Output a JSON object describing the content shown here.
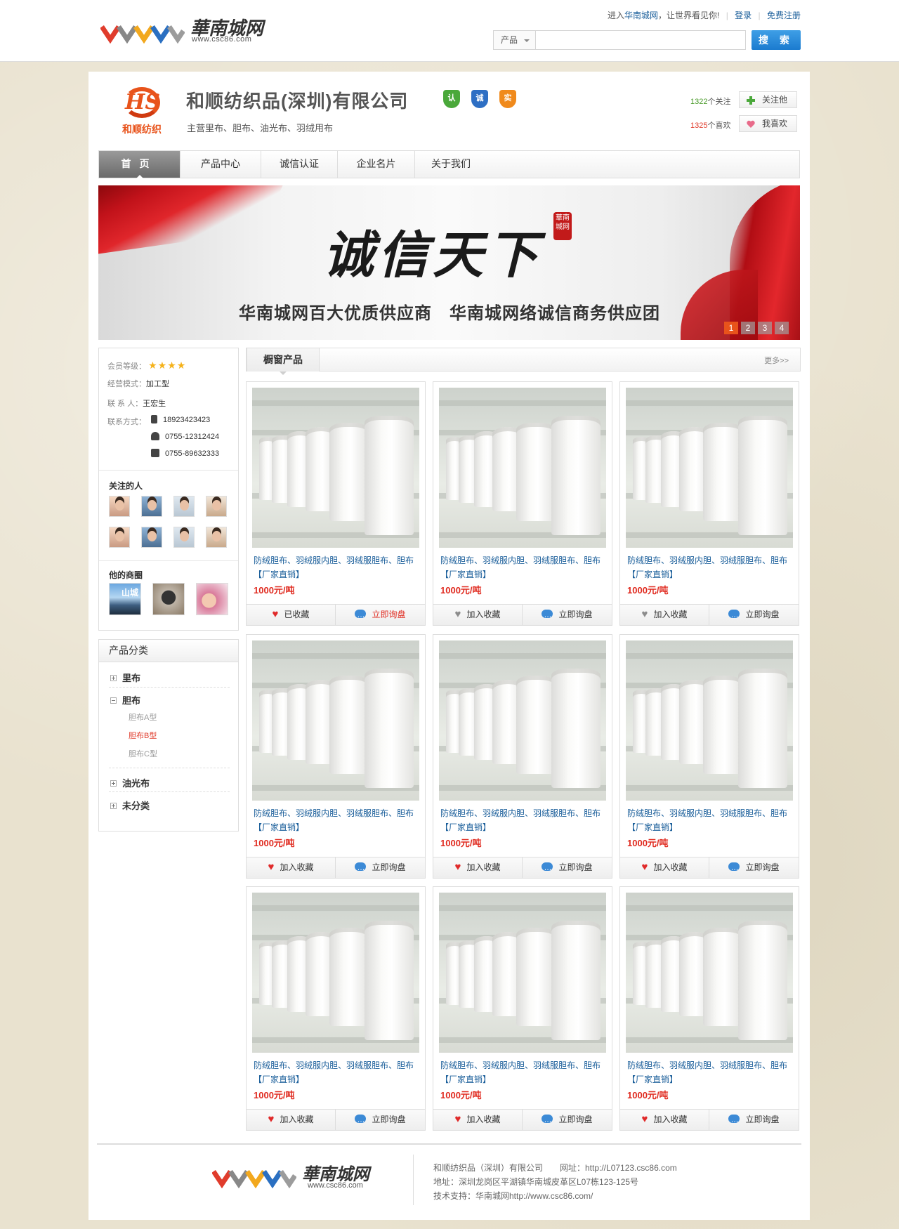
{
  "header": {
    "site_brand": "華南城网",
    "site_url": "www.csc86.com",
    "intro_prefix": "进入",
    "intro_site": "华南城网",
    "intro_suffix": "，让世界看见你!",
    "login": "登录",
    "register": "免费注册",
    "search_scope": "产品",
    "search_placeholder": "",
    "search_button": "搜 索"
  },
  "company": {
    "logo_letters": "HS",
    "logo_text": "和顺纺织",
    "name": "和顺纺织品(深圳)有限公司",
    "business": "主营里布、胆布、油光布、羽绒用布",
    "badges": [
      "认",
      "诚",
      "实"
    ],
    "follow_count": "1322",
    "follow_unit": "个关注",
    "follow_button": "关注他",
    "like_count": "1325",
    "like_unit": "个喜欢",
    "like_button": "我喜欢"
  },
  "nav": [
    "首页",
    "产品中心",
    "诚信认证",
    "企业名片",
    "关于我们"
  ],
  "banner": {
    "slogan": "诚信天下",
    "seal": "華南城网",
    "subline": "华南城网百大优质供应商　华南城网络诚信商务供应团",
    "pages": [
      "1",
      "2",
      "3",
      "4"
    ],
    "active_page": "1"
  },
  "sidebar": {
    "level_label": "会员等级：",
    "stars": 4,
    "mode_label": "经营模式：",
    "mode_value": "加工型",
    "contact_label": "联 系 人：",
    "contact_value": "王宏生",
    "method_label": "联系方式：",
    "mobile": "18923423423",
    "tel": "0755-12312424",
    "fax": "0755-89632333",
    "followers_title": "关注的人",
    "circles_title": "他的商圈",
    "circle_labels": [
      "山城",
      "",
      ""
    ]
  },
  "categories": {
    "title": "产品分类",
    "items": [
      {
        "label": "里布",
        "expanded": false
      },
      {
        "label": "胆布",
        "expanded": true,
        "children": [
          "胆布A型",
          "胆布B型",
          "胆布C型"
        ],
        "active_child": "胆布B型"
      },
      {
        "label": "油光布",
        "expanded": false
      },
      {
        "label": "未分类",
        "expanded": false
      }
    ]
  },
  "products": {
    "title": "橱窗产品",
    "more": "更多>>",
    "items": [
      {
        "title": "防绒胆布、羽绒服内胆、羽绒服胆布、胆布【厂家直销】",
        "price": "1000元/吨",
        "fav": "已收藏",
        "ask": "立即询盘",
        "fav_active": true
      },
      {
        "title": "防绒胆布、羽绒服内胆、羽绒服胆布、胆布【厂家直销】",
        "price": "1000元/吨",
        "fav": "加入收藏",
        "ask": "立即询盘",
        "fav_active": false
      },
      {
        "title": "防绒胆布、羽绒服内胆、羽绒服胆布、胆布【厂家直销】",
        "price": "1000元/吨",
        "fav": "加入收藏",
        "ask": "立即询盘",
        "fav_active": false
      },
      {
        "title": "防绒胆布、羽绒服内胆、羽绒服胆布、胆布【厂家直销】",
        "price": "1000元/吨",
        "fav": "加入收藏",
        "ask": "立即询盘",
        "fav_active": false
      },
      {
        "title": "防绒胆布、羽绒服内胆、羽绒服胆布、胆布【厂家直销】",
        "price": "1000元/吨",
        "fav": "加入收藏",
        "ask": "立即询盘",
        "fav_active": false
      },
      {
        "title": "防绒胆布、羽绒服内胆、羽绒服胆布、胆布【厂家直销】",
        "price": "1000元/吨",
        "fav": "加入收藏",
        "ask": "立即询盘",
        "fav_active": false
      },
      {
        "title": "防绒胆布、羽绒服内胆、羽绒服胆布、胆布【厂家直销】",
        "price": "1000元/吨",
        "fav": "加入收藏",
        "ask": "立即询盘",
        "fav_active": false
      },
      {
        "title": "防绒胆布、羽绒服内胆、羽绒服胆布、胆布【厂家直销】",
        "price": "1000元/吨",
        "fav": "加入收藏",
        "ask": "立即询盘",
        "fav_active": false
      },
      {
        "title": "防绒胆布、羽绒服内胆、羽绒服胆布、胆布【厂家直销】",
        "price": "1000元/吨",
        "fav": "加入收藏",
        "ask": "立即询盘",
        "fav_active": false
      }
    ]
  },
  "footer": {
    "brand": "華南城网",
    "url": "www.csc86.com",
    "line1": "和顺纺织品（深圳）有限公司　　网址：http://L07123.csc86.com",
    "line2": "地址：深圳龙岗区平湖镇华南城皮革区L07栋123-125号",
    "line3": "技术支持：华南城网http://www.csc86.com/"
  },
  "colors": {
    "accent_orange": "#e8531b",
    "link_blue": "#1a5e9a",
    "price_red": "#e02a1f",
    "search_blue": "#1b7bcf"
  }
}
